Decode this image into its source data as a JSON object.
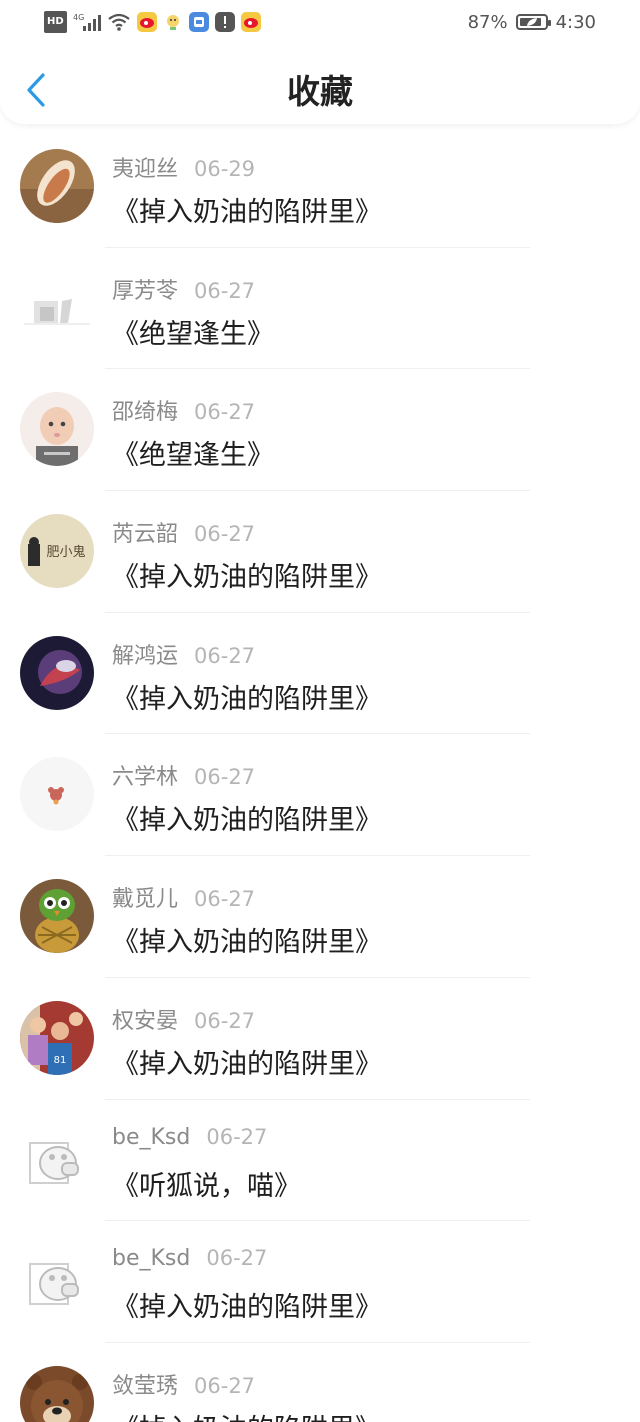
{
  "status_bar": {
    "hd": "HD",
    "network": "4G",
    "battery_percent": "87%",
    "time": "4:30",
    "battery_level": 0.87
  },
  "header": {
    "title": "收藏",
    "back_icon": "chevron-left-icon"
  },
  "favorites": [
    {
      "user": "夷迎丝",
      "date": "06-29",
      "title": "《掉入奶油的陷阱里》"
    },
    {
      "user": "厚芳苓",
      "date": "06-27",
      "title": "《绝望逢生》"
    },
    {
      "user": "邵绮梅",
      "date": "06-27",
      "title": "《绝望逢生》"
    },
    {
      "user": "芮云韶",
      "date": "06-27",
      "title": "《掉入奶油的陷阱里》",
      "avatar_text": "肥小鬼"
    },
    {
      "user": "解鸿运",
      "date": "06-27",
      "title": "《掉入奶油的陷阱里》"
    },
    {
      "user": "六学林",
      "date": "06-27",
      "title": "《掉入奶油的陷阱里》"
    },
    {
      "user": "戴觅儿",
      "date": "06-27",
      "title": "《掉入奶油的陷阱里》"
    },
    {
      "user": "权安晏",
      "date": "06-27",
      "title": "《掉入奶油的陷阱里》"
    },
    {
      "user": "be_Ksd",
      "date": "06-27",
      "title": "《听狐说，喵》"
    },
    {
      "user": "be_Ksd",
      "date": "06-27",
      "title": "《掉入奶油的陷阱里》"
    },
    {
      "user": "敛莹琇",
      "date": "06-27",
      "title": "《掉入奶油的陷阱里》"
    }
  ]
}
